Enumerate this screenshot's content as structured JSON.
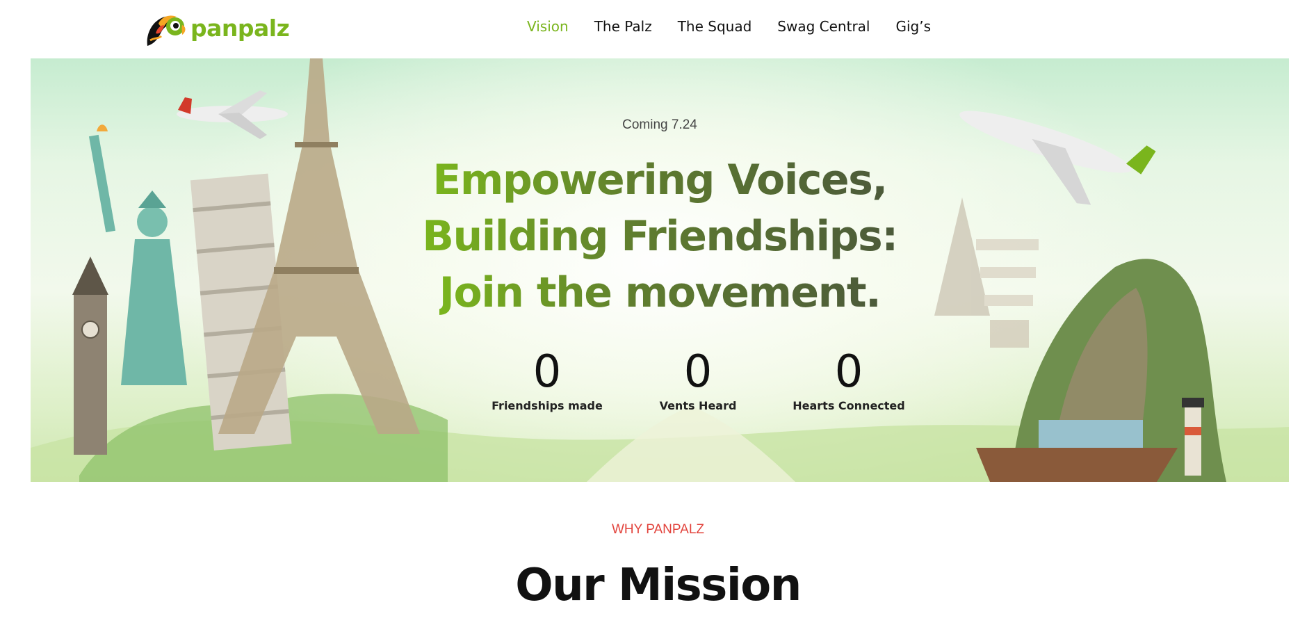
{
  "brand": {
    "name": "panpalz",
    "accent": "#7ab51d"
  },
  "nav": {
    "items": [
      {
        "label": "Vision",
        "active": true
      },
      {
        "label": "The Palz",
        "active": false
      },
      {
        "label": "The Squad",
        "active": false
      },
      {
        "label": "Swag Central",
        "active": false
      },
      {
        "label": "Gig’s",
        "active": false
      }
    ]
  },
  "hero": {
    "coming": "Coming 7.24",
    "headline": [
      "Empowering Voices,",
      "Building Friendships:",
      "Join the movement."
    ],
    "stats": [
      {
        "value": "0",
        "label": "Friendships made"
      },
      {
        "value": "0",
        "label": "Vents Heard"
      },
      {
        "value": "0",
        "label": "Hearts Connected"
      }
    ]
  },
  "section": {
    "eyebrow": "WHY PANPALZ",
    "title": "Our Mission",
    "eyebrow_color": "#e2433c"
  }
}
